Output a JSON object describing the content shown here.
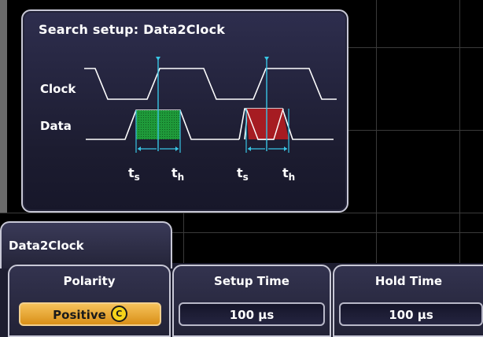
{
  "dialog": {
    "title": "Search setup: Data2Clock",
    "clock_label": "Clock",
    "data_label": "Data",
    "setup_label": {
      "t": "t",
      "sub": "s"
    },
    "hold_label": {
      "t": "t",
      "sub": "h"
    }
  },
  "menu": {
    "tab_label": "Data2Clock",
    "polarity": {
      "label": "Polarity",
      "value": "Positive",
      "icon": "C"
    },
    "setup_time": {
      "label": "Setup Time",
      "value": "100 µs"
    },
    "hold_time": {
      "label": "Hold Time",
      "value": "100 µs"
    }
  },
  "colors": {
    "valid_fill": "#1f9a3a",
    "violation_fill": "#a61c22",
    "marker": "#39c6e6",
    "accent_orange": "#e8a02c"
  },
  "icons": {
    "polarity_toggle": "circle-c-icon",
    "trigger_marker": "triangle-down-icon"
  }
}
